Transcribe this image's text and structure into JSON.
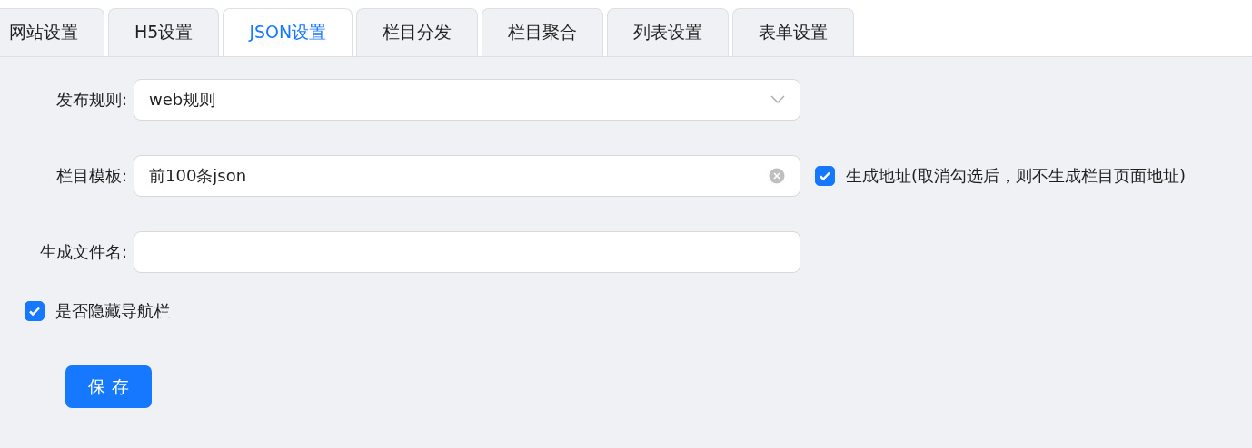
{
  "tabs": [
    {
      "label": "网站设置",
      "selected": false
    },
    {
      "label": "H5设置",
      "selected": false
    },
    {
      "label": "JSON设置",
      "selected": true
    },
    {
      "label": "栏目分发",
      "selected": false
    },
    {
      "label": "栏目聚合",
      "selected": false
    },
    {
      "label": "列表设置",
      "selected": false
    },
    {
      "label": "表单设置",
      "selected": false
    }
  ],
  "form": {
    "fields": [
      {
        "kind": "select",
        "label": "发布规则:",
        "value": "web规则"
      },
      {
        "kind": "clearable",
        "label": "栏目模板:",
        "value": "前100条json",
        "checkbox": {
          "label": "生成地址(取消勾选后，则不生成栏目页面地址)",
          "checked": true
        }
      },
      {
        "kind": "text",
        "label": "生成文件名:"
      }
    ],
    "hide_nav": {
      "label": "是否隐藏导航栏",
      "checked": true
    },
    "save_button": "保 存"
  }
}
